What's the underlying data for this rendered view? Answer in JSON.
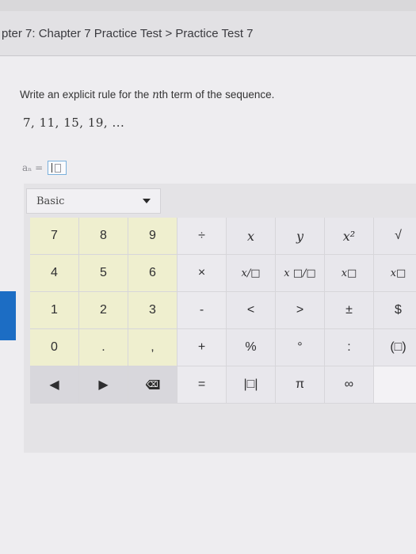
{
  "breadcrumb": {
    "text": "pter 7: Chapter 7 Practice Test > Practice Test 7"
  },
  "question": {
    "prefix": "Write an explicit rule for the ",
    "n": "n",
    "suffix": "th term of the sequence.",
    "sequence": "7, 11, 15, 19, ..."
  },
  "answer": {
    "label": "aₙ ="
  },
  "keypad": {
    "mode": "Basic",
    "rows": [
      [
        "7",
        "8",
        "9",
        "÷",
        "x",
        "y",
        "x²",
        "√"
      ],
      [
        "4",
        "5",
        "6",
        "×",
        "x/□",
        "x □/□",
        "x□",
        "x□"
      ],
      [
        "1",
        "2",
        "3",
        "-",
        "<",
        ">",
        "±",
        "$"
      ],
      [
        "0",
        ".",
        ",",
        "+",
        "%",
        "°",
        ":",
        "(□)"
      ],
      [
        "◀",
        "▶",
        "⌫",
        "=",
        "|□|",
        "π",
        "∞",
        ""
      ]
    ]
  },
  "colors": {
    "accent": "#1c6dc4",
    "number_key": "#efefcf"
  }
}
